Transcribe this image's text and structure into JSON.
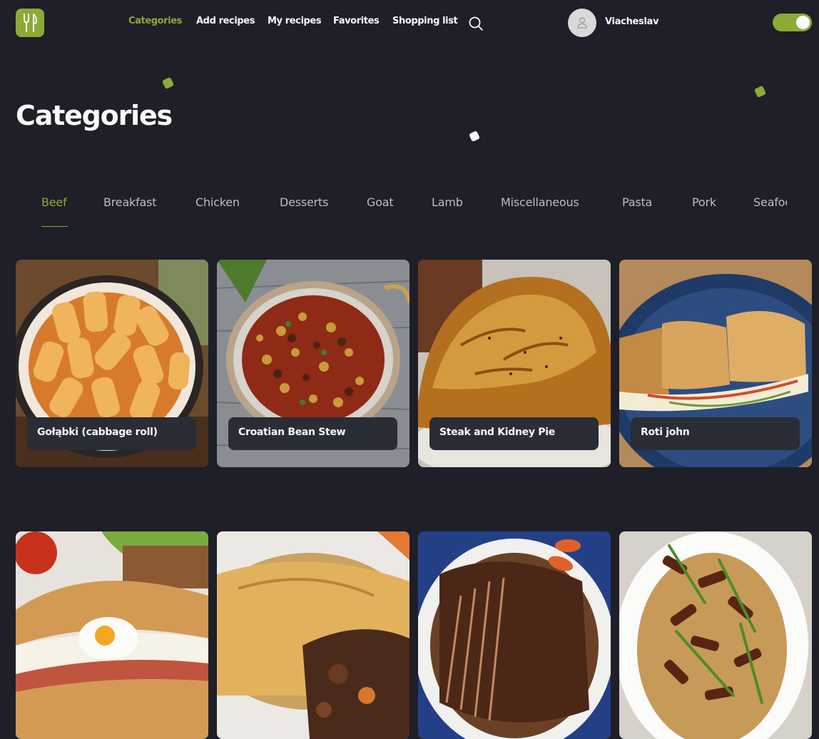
{
  "header": {
    "nav": [
      {
        "label": "Categories",
        "active": true
      },
      {
        "label": "Add recipes",
        "active": false
      },
      {
        "label": "My recipes",
        "active": false
      },
      {
        "label": "Favorites",
        "active": false
      },
      {
        "label": "Shopping list",
        "active": false
      }
    ],
    "user_name": "Viacheslav",
    "theme_toggle_on": true
  },
  "page_title": "Categories",
  "categories": [
    "Beef",
    "Breakfast",
    "Chicken",
    "Desserts",
    "Goat",
    "Lamb",
    "Miscellaneous",
    "Pasta",
    "Pork",
    "Seafood"
  ],
  "selected_category": "Beef",
  "recipes": [
    {
      "title": "Gołąbki (cabbage roll)",
      "image": "cabbage-rolls-in-pan"
    },
    {
      "title": "Croatian Bean Stew",
      "image": "bean-stew-in-pot"
    },
    {
      "title": "Steak and Kidney Pie",
      "image": "golden-pie-crust"
    },
    {
      "title": "Roti john",
      "image": "omelette-sandwich"
    },
    {
      "title": "",
      "image": "egg-sandwich-baguette"
    },
    {
      "title": "",
      "image": "meat-pie-slice"
    },
    {
      "title": "",
      "image": "sliced-brisket"
    },
    {
      "title": "",
      "image": "beef-asparagus-stir-fry"
    }
  ],
  "colors": {
    "background": "#1e1f28",
    "accent": "#8baa36",
    "label_bg": "#2a2c36",
    "text": "#fafafa",
    "tab_text": "#bdbdbd"
  },
  "icons": {
    "logo": "fork-knife-icon",
    "search": "search-icon",
    "avatar": "user-icon"
  }
}
